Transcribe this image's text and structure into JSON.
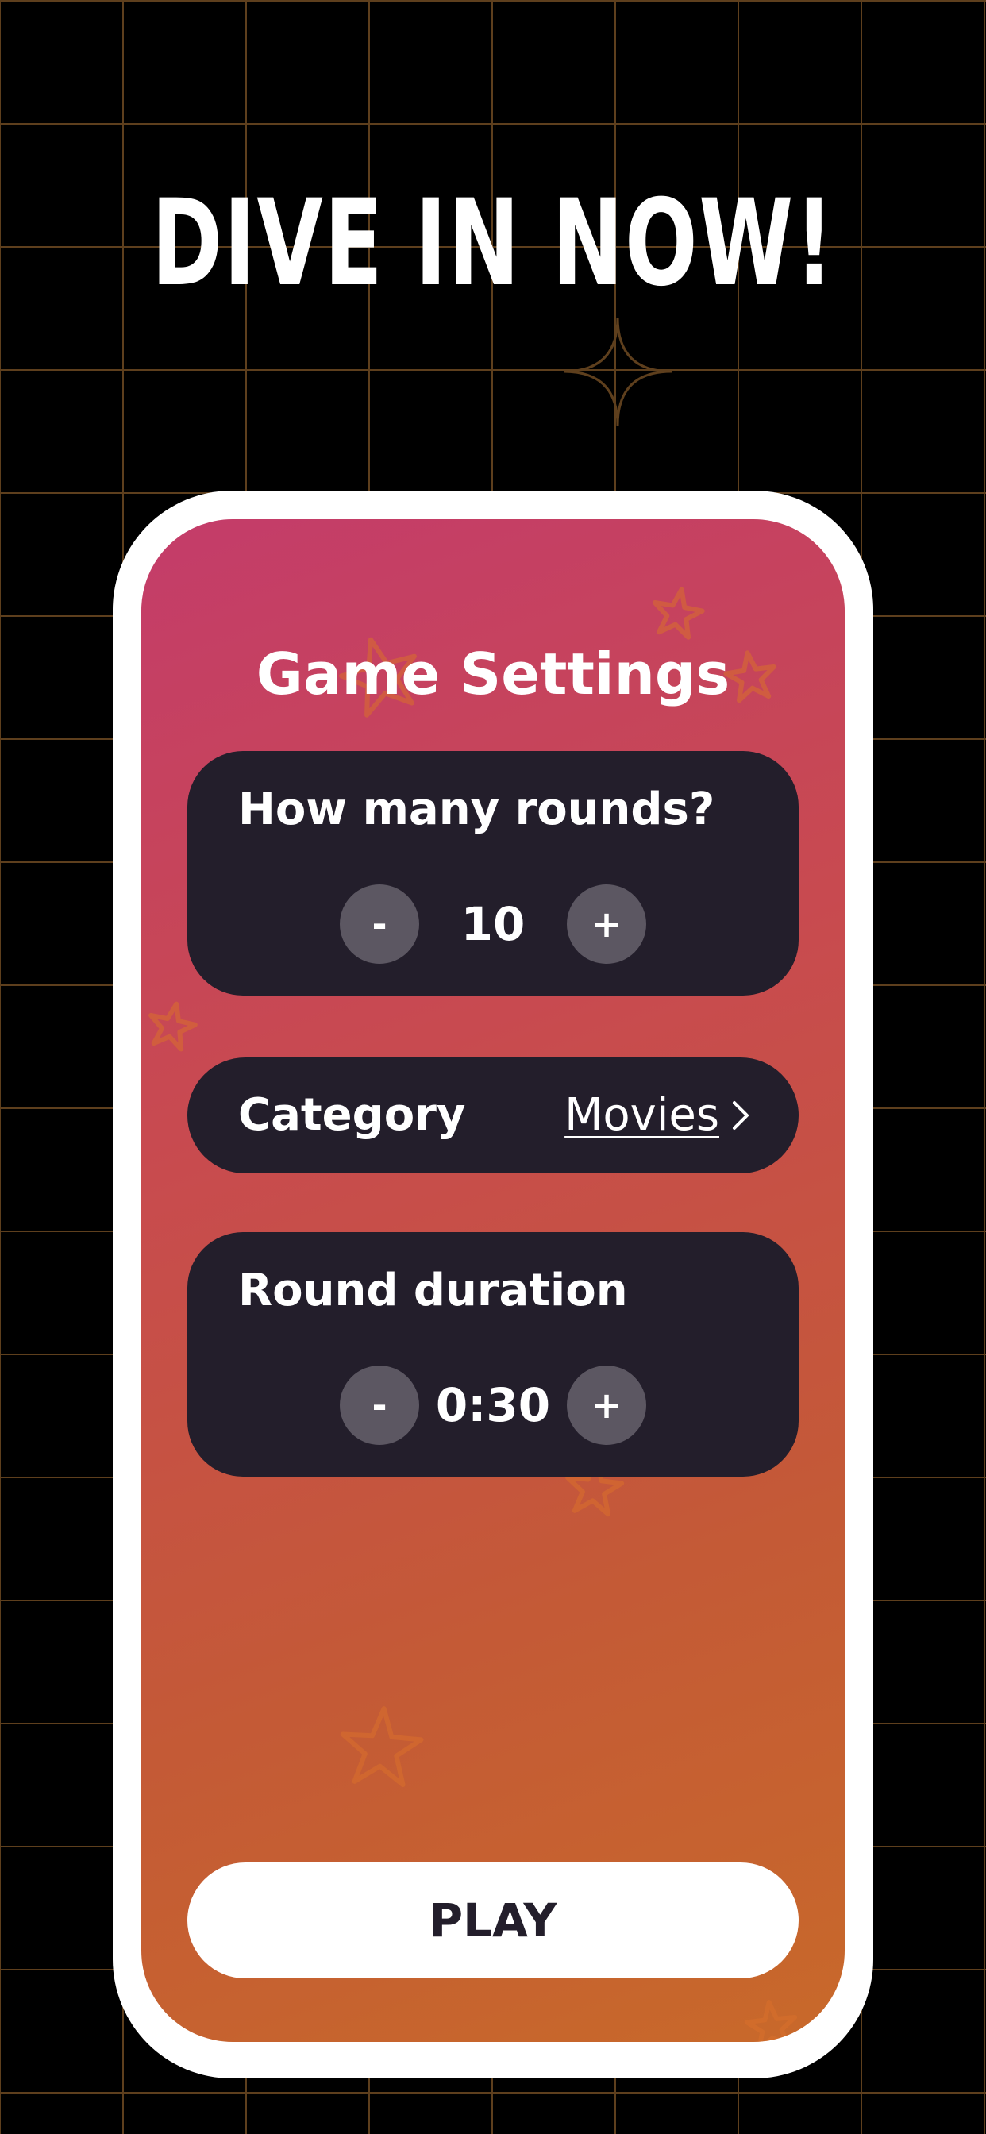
{
  "headline": "DIVE IN NOW!",
  "screen": {
    "title": "Game Settings",
    "rounds": {
      "label": "How many rounds?",
      "value": "10",
      "minus": "-",
      "plus": "+"
    },
    "category": {
      "label": "Category",
      "value": "Movies"
    },
    "duration": {
      "label": "Round duration",
      "value": "0:30",
      "minus": "-",
      "plus": "+"
    },
    "play_label": "PLAY"
  },
  "colors": {
    "background": "#000000",
    "grid_line": "#5e3f1d",
    "gradient_start": "#c43c6a",
    "gradient_end": "#c8692a",
    "card": "#231e2b",
    "stepper_button": "#5c5762",
    "play_button": "#ffffff"
  },
  "icons": [
    "sparkle-icon",
    "star-icon",
    "chevron-right-icon"
  ]
}
